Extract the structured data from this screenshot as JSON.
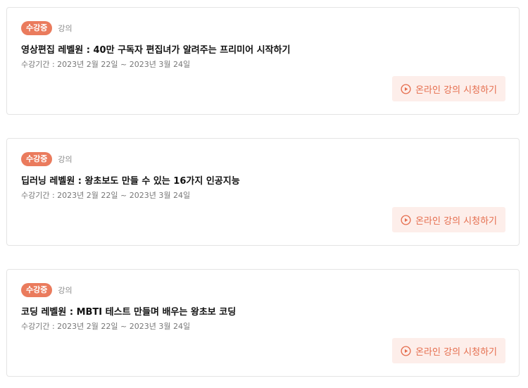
{
  "colors": {
    "accent": "#ea7b5d",
    "button_bg": "#fdeeea",
    "button_text": "#e56d4d",
    "border": "#e4e4e4"
  },
  "courses": [
    {
      "status": "수강중",
      "type": "강의",
      "title": "영상편집 레벨원 : 40만 구독자 편집녀가 알려주는 프리미어 시작하기",
      "period": "수강기간 : 2023년 2월 22일 ~ 2023년 3월 24일",
      "button_label": "온라인 강의 시청하기",
      "button_icon": "play-circle-icon"
    },
    {
      "status": "수강중",
      "type": "강의",
      "title": "딥러닝 레벨원 : 왕초보도 만들 수 있는 16가지 인공지능",
      "period": "수강기간 : 2023년 2월 22일 ~ 2023년 3월 24일",
      "button_label": "온라인 강의 시청하기",
      "button_icon": "play-circle-icon"
    },
    {
      "status": "수강중",
      "type": "강의",
      "title": "코딩 레벨원 : MBTI 테스트 만들며 배우는 왕초보 코딩",
      "period": "수강기간 : 2023년 2월 22일 ~ 2023년 3월 24일",
      "button_label": "온라인 강의 시청하기",
      "button_icon": "play-circle-icon"
    }
  ]
}
